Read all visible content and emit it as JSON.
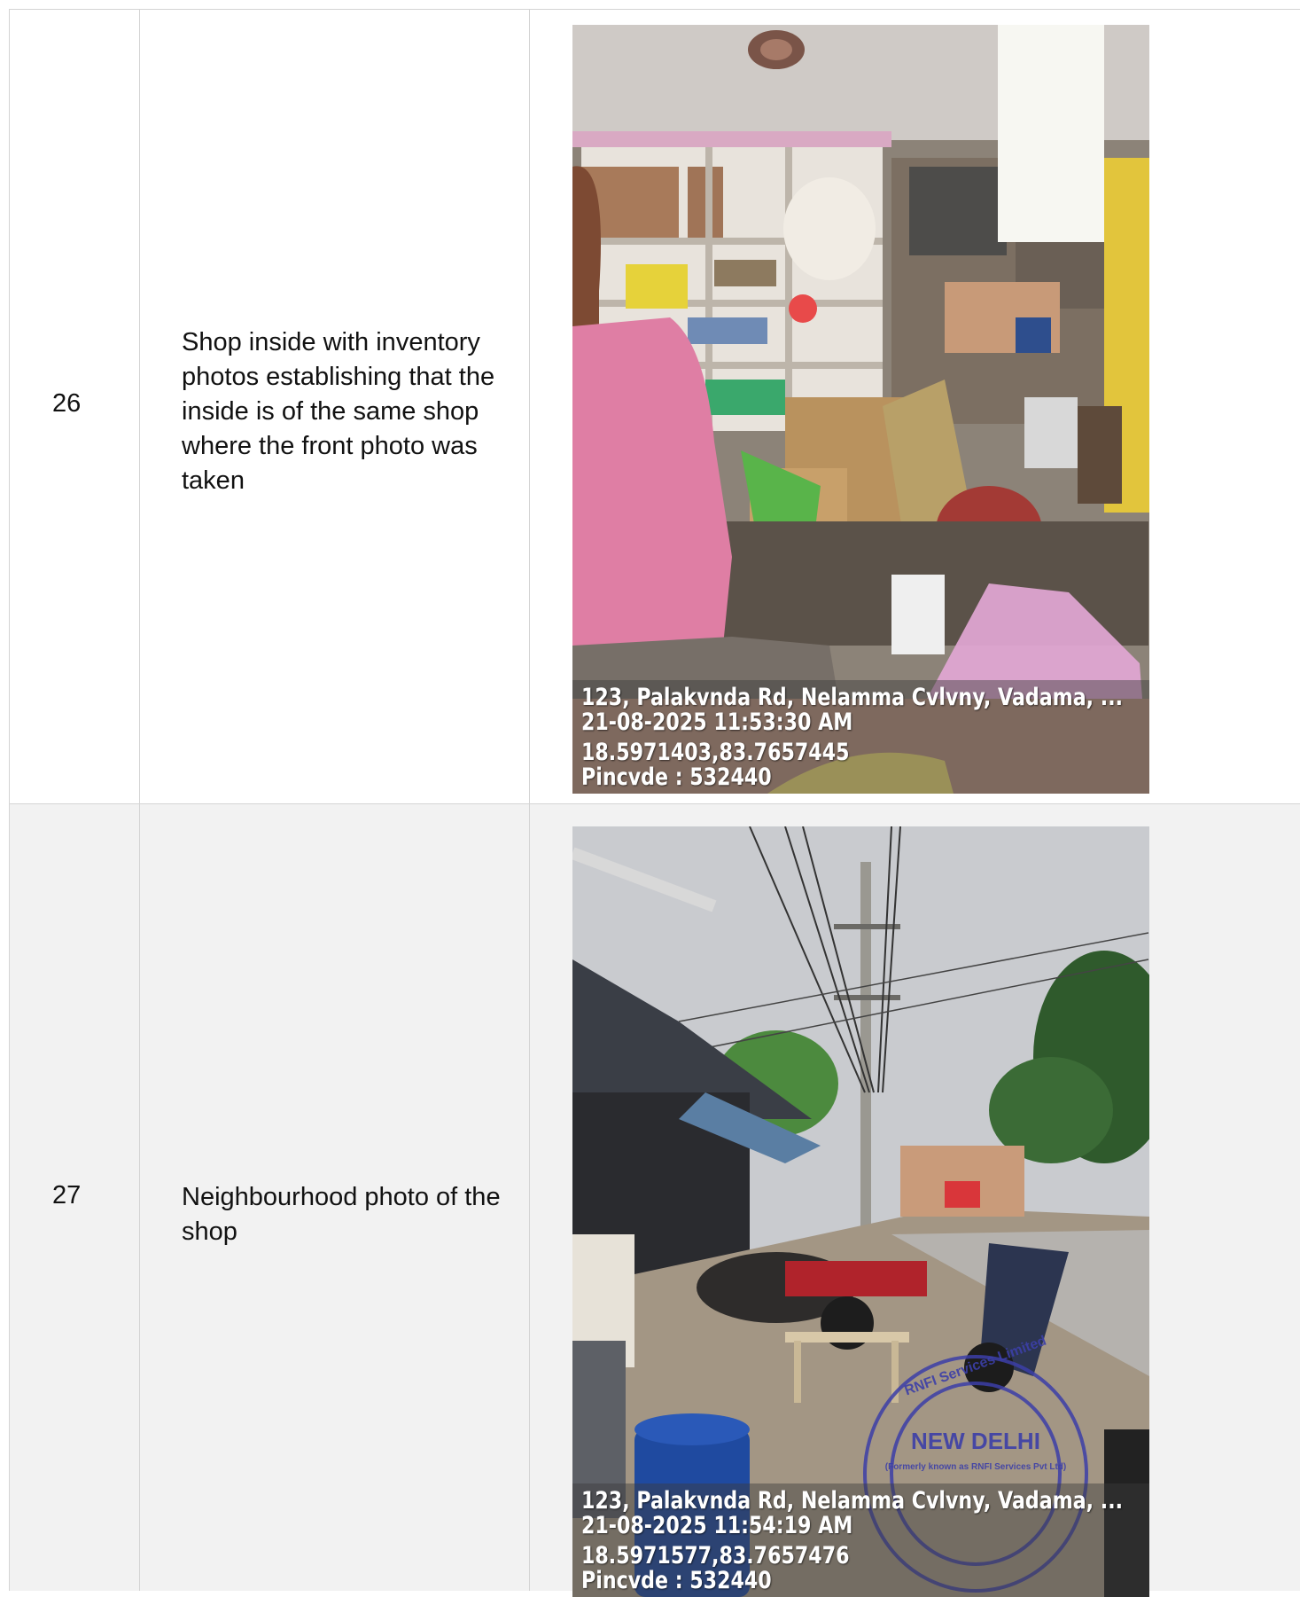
{
  "rows": [
    {
      "number": "26",
      "description": "Shop inside with inventory photos establishing that the inside is of the same shop where the front photo was taken",
      "photo": {
        "address": "123, Palakvnda Rd, Nelamma Cvlvny, Vadama, ...",
        "datetime": "21-08-2025 11:53:30 AM",
        "coords": "18.5971403,83.7657445",
        "pincode": "Pincvde : 532440"
      }
    },
    {
      "number": "27",
      "description": "Neighbourhood photo of the shop",
      "photo": {
        "address": "123, Palakvnda Rd, Nelamma Cvlvny, Vadama, ...",
        "datetime": "21-08-2025 11:54:19 AM",
        "coords": "18.5971577,83.7657476",
        "pincode": "Pincvde : 532440",
        "seal_text": [
          "RNFI Services Limited",
          "NEW DELHI",
          "(Formerly known as RNFI Services Pvt Ltd)"
        ]
      }
    }
  ]
}
